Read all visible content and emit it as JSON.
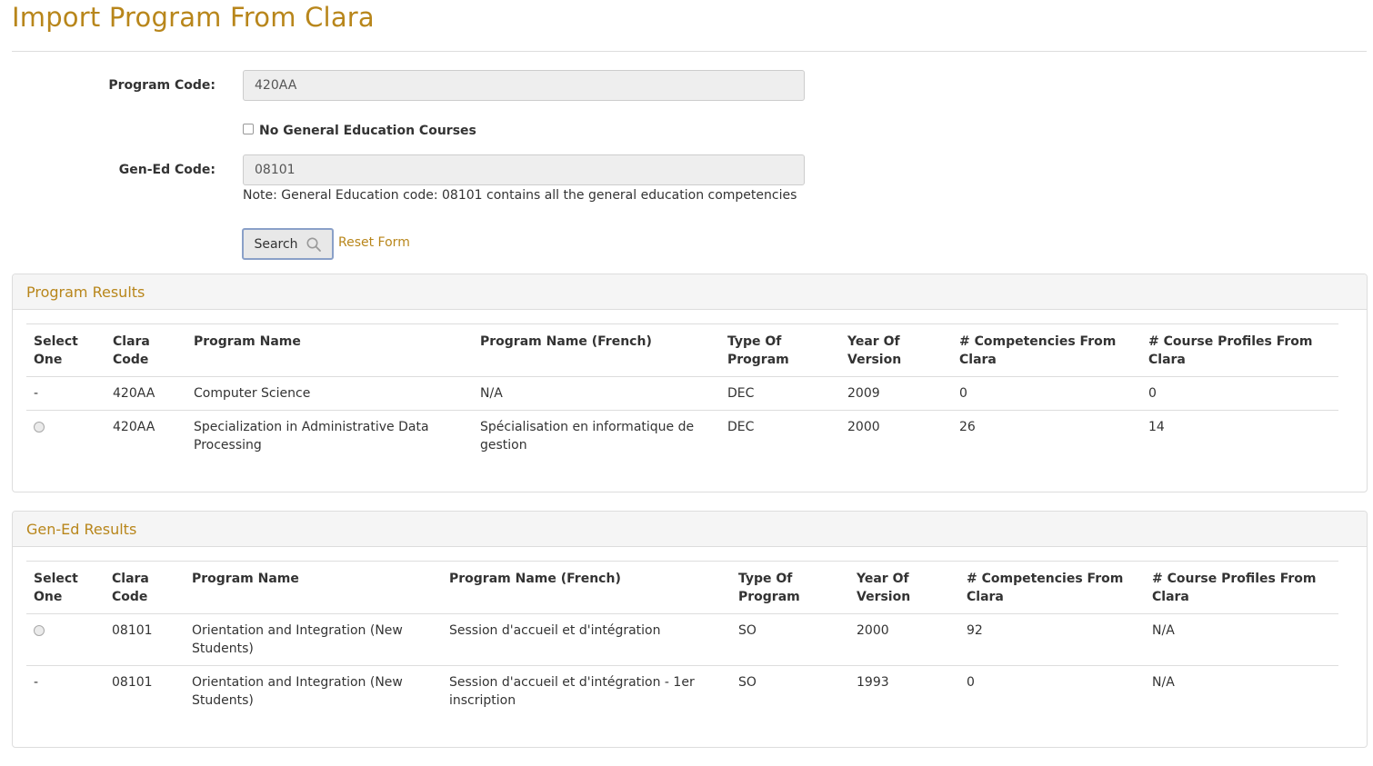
{
  "page": {
    "title": "Import Program From Clara"
  },
  "form": {
    "program_code_label": "Program Code:",
    "program_code_value": "420AA",
    "no_gen_ed_label": "No General Education Courses",
    "gen_ed_label": "Gen-Ed Code:",
    "gen_ed_value": "08101",
    "note": "Note: General Education code: 08101 contains all the general education competencies",
    "search_label": "Search",
    "reset_label": "Reset Form"
  },
  "columns": {
    "select_one": "Select One",
    "clara_code": "Clara Code",
    "program_name": "Program Name",
    "program_name_french": "Program Name (French)",
    "type_of_program": "Type Of Program",
    "year_of_version": "Year Of Version",
    "competencies": "# Competencies From Clara",
    "course_profiles": "# Course Profiles From Clara"
  },
  "program_results": {
    "heading": "Program Results",
    "rows": [
      {
        "select": "-",
        "code": "420AA",
        "name": "Computer Science",
        "name_fr": "N/A",
        "type": "DEC",
        "year": "2009",
        "competencies": "0",
        "profiles": "0"
      },
      {
        "select": "radio",
        "code": "420AA",
        "name": "Specialization in Administrative Data Processing",
        "name_fr": "Spécialisation en informatique de gestion",
        "type": "DEC",
        "year": "2000",
        "competencies": "26",
        "profiles": "14"
      }
    ]
  },
  "gened_results": {
    "heading": "Gen-Ed Results",
    "rows": [
      {
        "select": "radio",
        "code": "08101",
        "name": "Orientation and Integration (New Students)",
        "name_fr": "Session d'accueil et d'intégration",
        "type": "SO",
        "year": "2000",
        "competencies": "92",
        "profiles": "N/A"
      },
      {
        "select": "-",
        "code": "08101",
        "name": "Orientation and Integration (New Students)",
        "name_fr": "Session d'accueil et d'intégration - 1er inscription",
        "type": "SO",
        "year": "1993",
        "competencies": "0",
        "profiles": "N/A"
      }
    ]
  },
  "colors": {
    "accent": "#b8861b",
    "border": "#dddddd",
    "panel_heading_bg": "#f5f5f5"
  }
}
